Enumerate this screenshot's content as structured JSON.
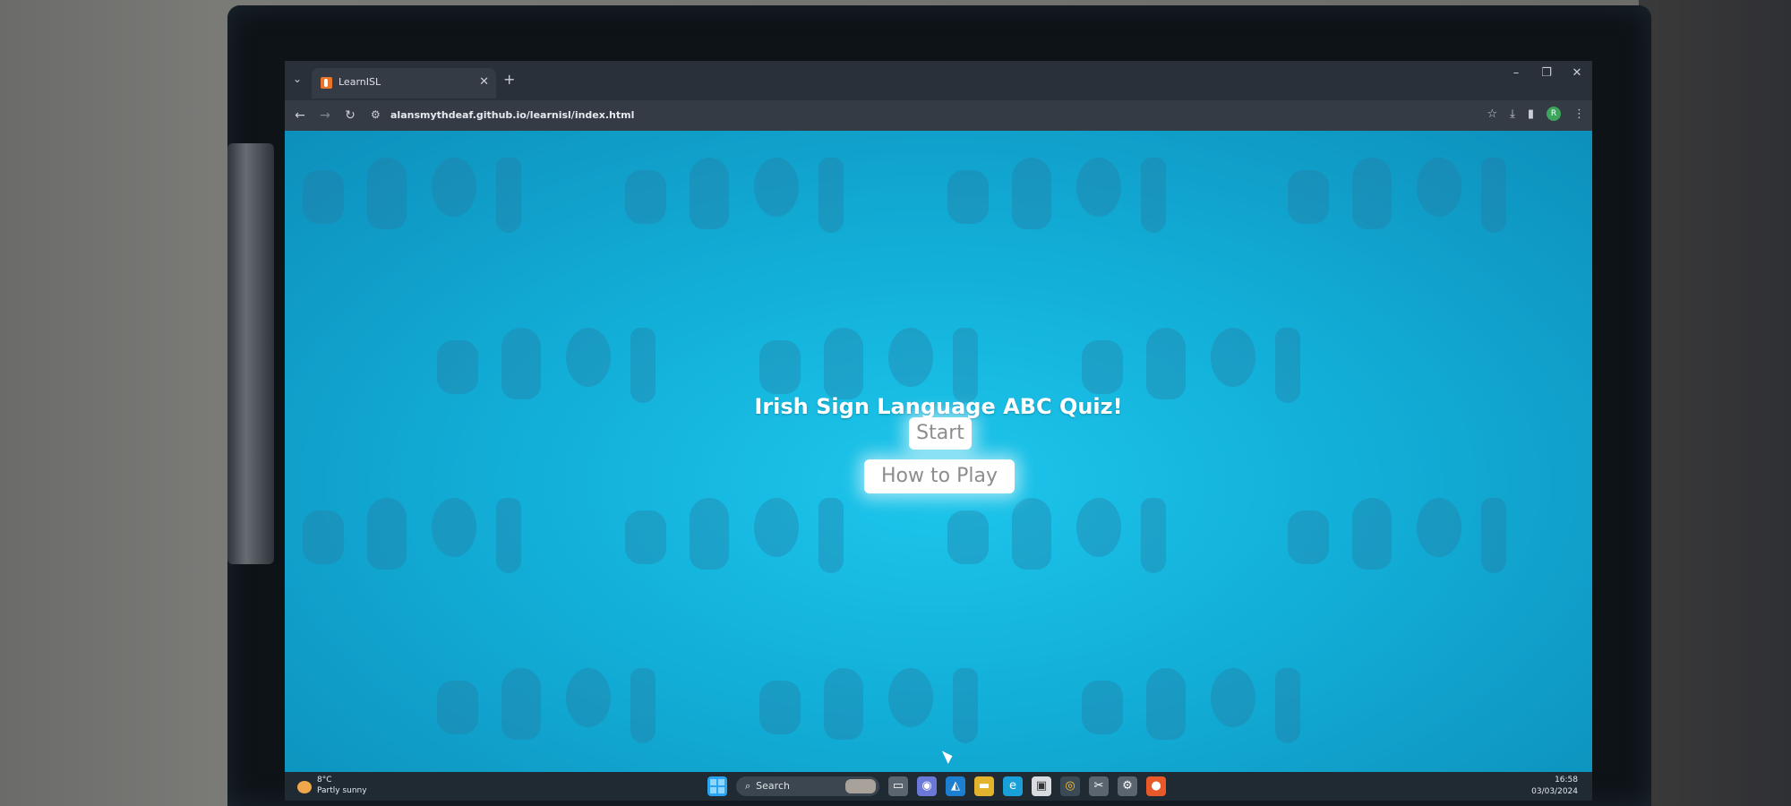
{
  "browser": {
    "tab_title": "LearnISL",
    "url": "alansmythdeaf.github.io/learnisl/index.html",
    "profile_initial": "R"
  },
  "page": {
    "title": "Irish Sign Language ABC Quiz!",
    "start_label": "Start",
    "how_to_play_label": "How to Play"
  },
  "taskbar": {
    "weather_temp": "8°C",
    "weather_desc": "Partly sunny",
    "search_label": "Search",
    "time": "16:58",
    "date": "03/03/2024"
  },
  "icons": {
    "tab_list": "chevron-down-icon",
    "favicon": "learnisl-favicon-icon",
    "tab_close": "close-icon",
    "new_tab": "plus-icon",
    "back": "arrow-left-icon",
    "forward": "arrow-right-icon",
    "reload": "reload-icon",
    "site_info": "tune-icon",
    "bookmark": "star-icon",
    "downloads": "download-icon",
    "side_panel": "side-panel-icon",
    "menu": "kebab-menu-icon"
  },
  "colors": {
    "page_bg": "#12afd8",
    "button_bg": "#ffffff",
    "button_text": "#8d8d8d",
    "title_text": "#ffffff"
  }
}
